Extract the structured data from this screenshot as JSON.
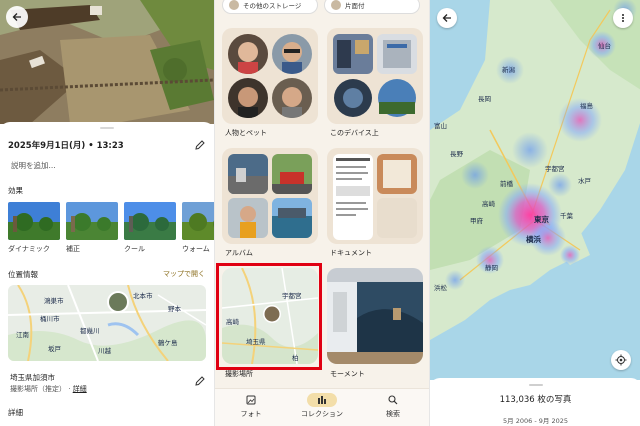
{
  "detail": {
    "datetime": "2025年9月1日(月) • 13:23",
    "description_placeholder": "説明を追加...",
    "effects_heading": "効果",
    "effects": [
      {
        "label": "ダイナミック"
      },
      {
        "label": "補正"
      },
      {
        "label": "クール"
      },
      {
        "label": "ウォーム"
      }
    ],
    "location_heading": "位置情報",
    "map_link": "マップで開く",
    "map_labels": [
      "鴻巣市",
      "桶川市",
      "北本市",
      "都幾川",
      "坂戸",
      "川越",
      "鶴ケ島",
      "野本",
      "江南"
    ],
    "location_name": "埼玉県加須市",
    "location_source": "撮影場所（推定）",
    "location_source_link": "詳細",
    "details_heading": "詳細"
  },
  "collections": {
    "top_chips": [
      {
        "label": "その他のストレージ"
      },
      {
        "label": "片面付"
      }
    ],
    "cards": [
      {
        "label": "人物とペット"
      },
      {
        "label": "このデバイス上"
      },
      {
        "label": "アルバム"
      },
      {
        "label": "ドキュメント"
      },
      {
        "label": "撮影場所"
      },
      {
        "label": "モーメント"
      }
    ],
    "places_map_labels": [
      "宇都宮",
      "高崎",
      "埼玉県",
      "柏"
    ],
    "nav": [
      {
        "label": "フォト",
        "icon": "photo-icon"
      },
      {
        "label": "コレクション",
        "icon": "collection-icon"
      },
      {
        "label": "検索",
        "icon": "search-icon"
      }
    ],
    "highlight_color": "#e00012"
  },
  "map": {
    "cities": [
      "仙台",
      "新潟",
      "長岡",
      "福島",
      "長野",
      "宇都宮",
      "前橋",
      "水戸",
      "東京",
      "横浜",
      "千葉",
      "静岡",
      "浜松",
      "甲府",
      "富山",
      "高崎"
    ],
    "photo_count": "113,036 枚の写真",
    "date_range": "5月 2006 - 9月 2025"
  },
  "colors": {
    "accent": "#8a6d1d",
    "nav_active": "#f3dea9",
    "card_bg": "#eee3d4",
    "heat_high": "#e24bb5",
    "heat_low": "#6aa7ff"
  }
}
